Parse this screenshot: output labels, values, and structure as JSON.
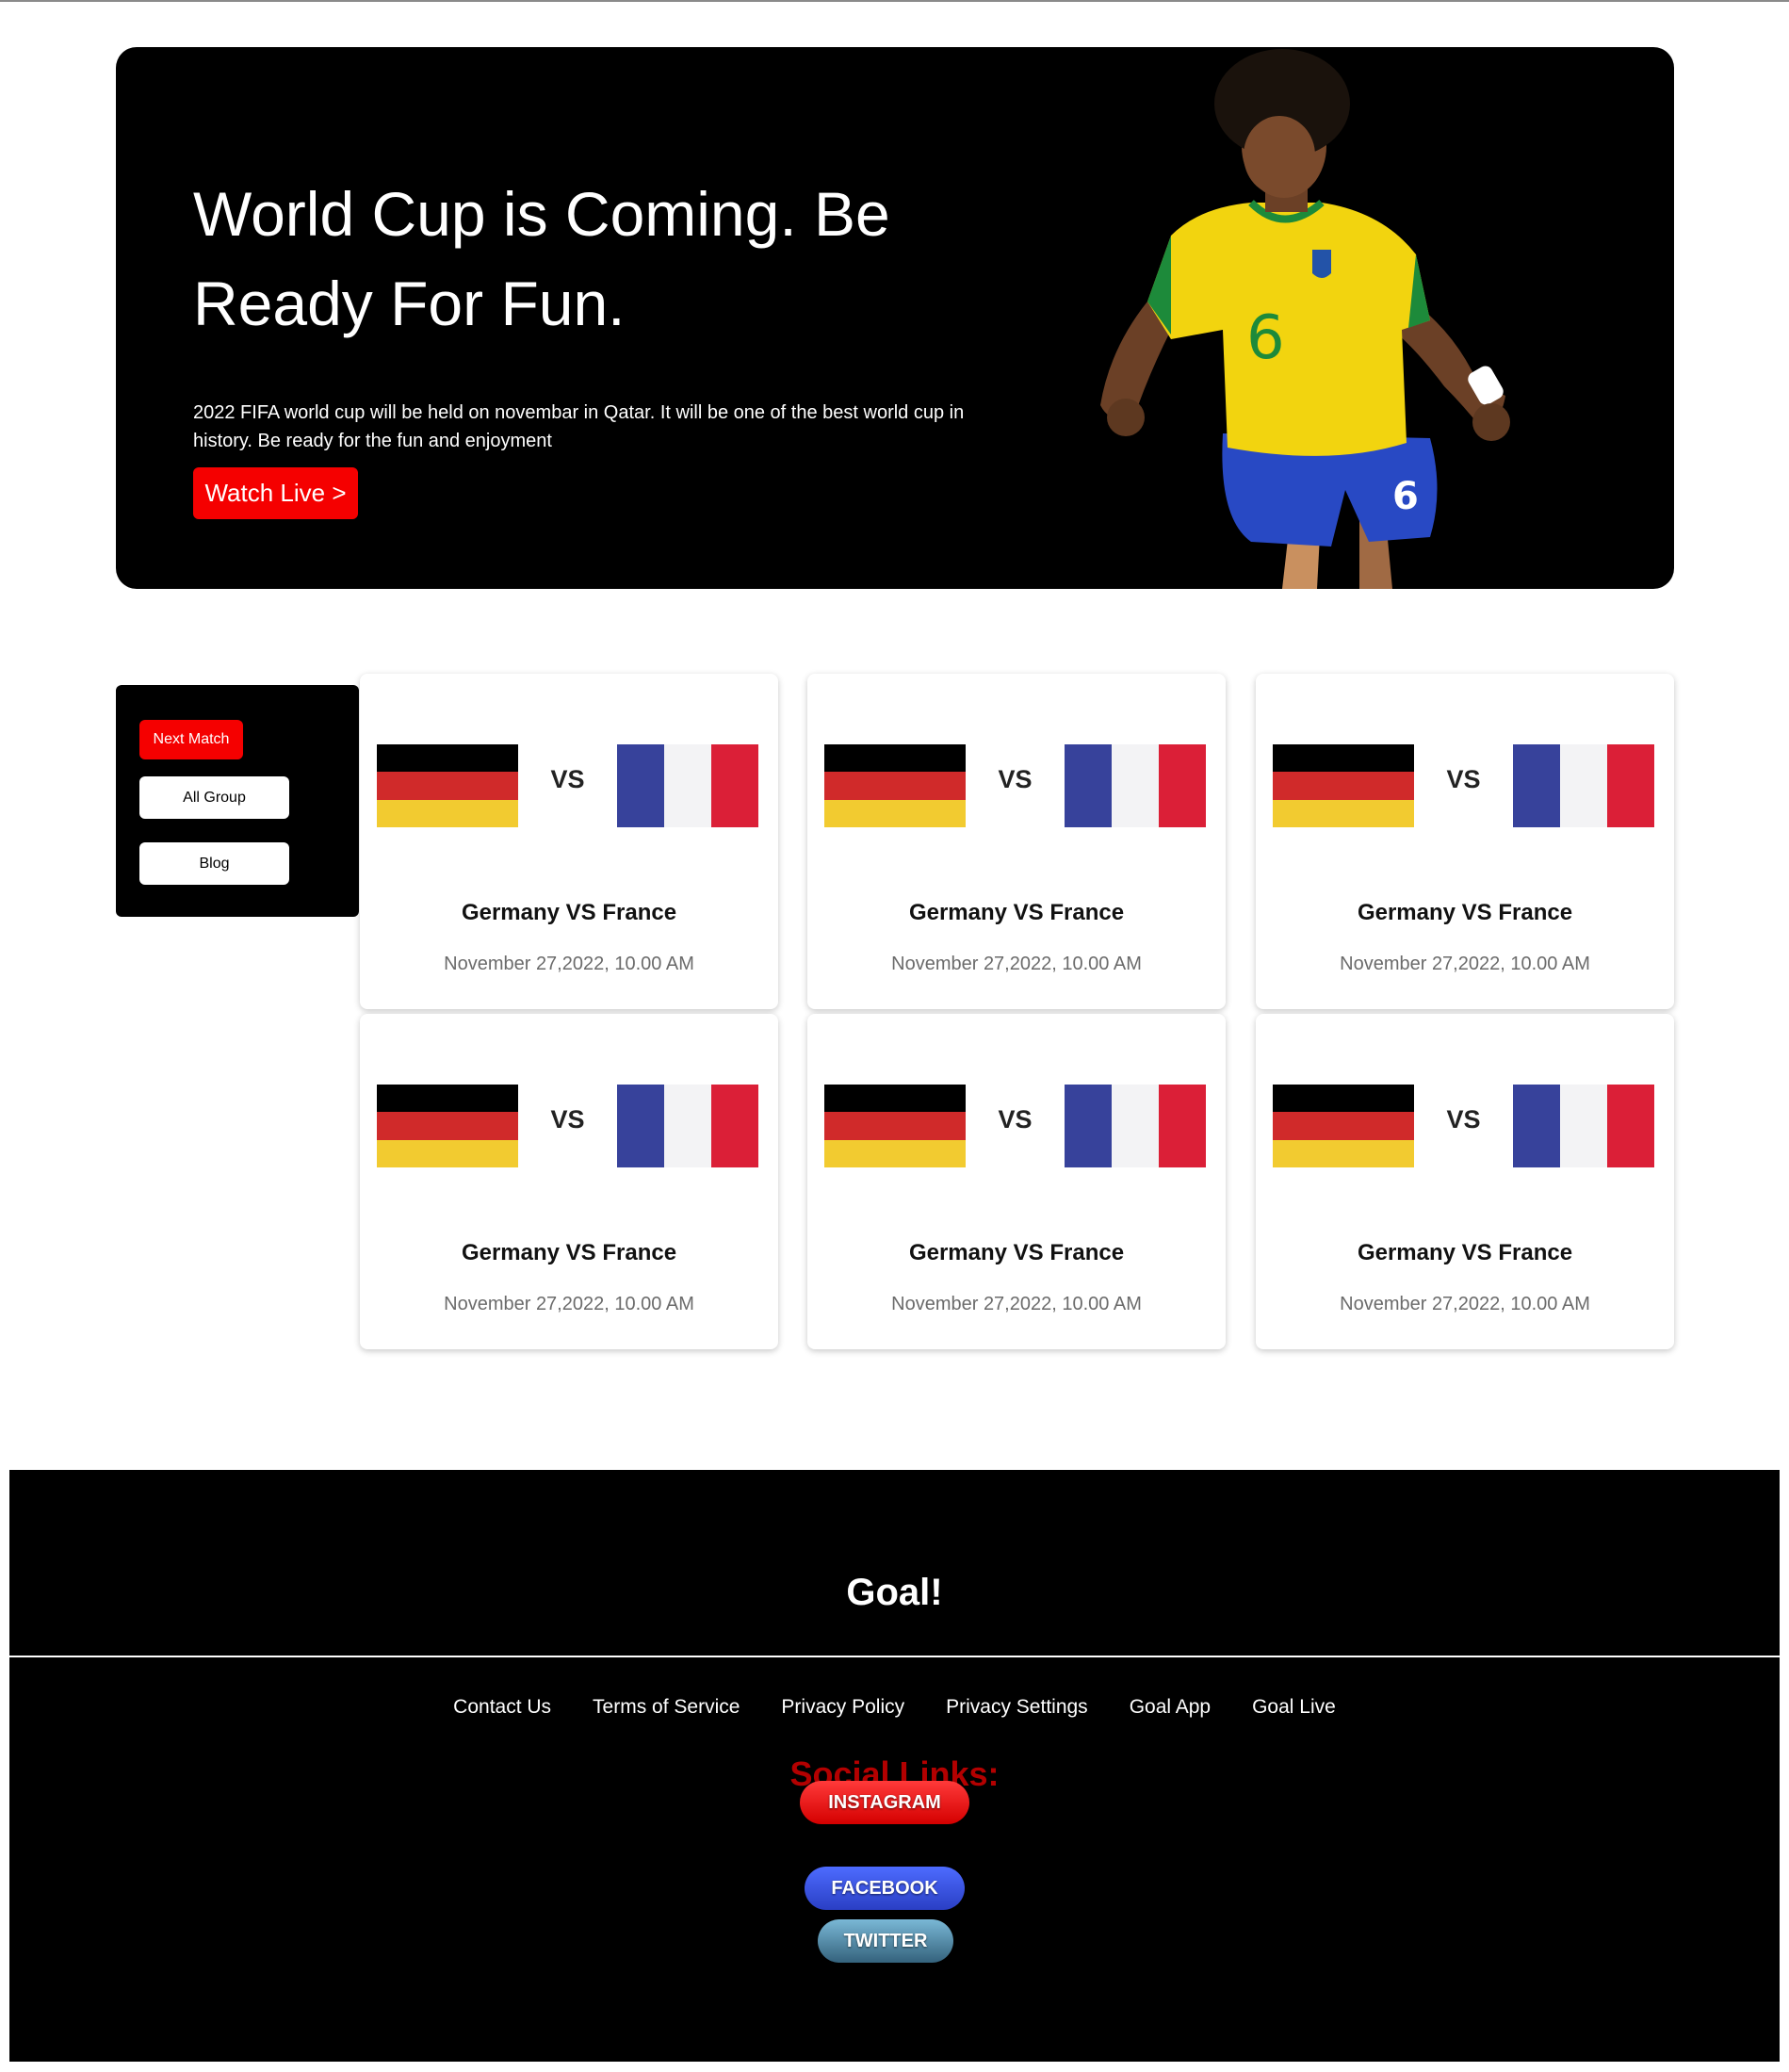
{
  "hero": {
    "title": "World Cup is Coming. Be Ready For Fun.",
    "description": "2022 FIFA world cup will be held on novembar in Qatar. It will be one of the best world cup in history. Be ready for the fun and enjoyment",
    "cta_label": "Watch Live >",
    "player_jersey_number": "6"
  },
  "sidebar": {
    "next_match_label": "Next Match",
    "all_group_label": "All Group",
    "blog_label": "Blog"
  },
  "matches": [
    {
      "vs": "VS",
      "title": "Germany VS France",
      "date": "November 27,2022, 10.00 AM"
    },
    {
      "vs": "VS",
      "title": "Germany VS France",
      "date": "November 27,2022, 10.00 AM"
    },
    {
      "vs": "VS",
      "title": "Germany VS France",
      "date": "November 27,2022, 10.00 AM"
    },
    {
      "vs": "VS",
      "title": "Germany VS France",
      "date": "November 27,2022, 10.00 AM"
    },
    {
      "vs": "VS",
      "title": "Germany VS France",
      "date": "November 27,2022, 10.00 AM"
    },
    {
      "vs": "VS",
      "title": "Germany VS France",
      "date": "November 27,2022, 10.00 AM"
    }
  ],
  "footer": {
    "brand": "Goal!",
    "links": [
      "Contact Us",
      "Terms of Service",
      "Privacy Policy",
      "Privacy Settings",
      "Goal App",
      "Goal Live"
    ],
    "social_title": "Social Links:",
    "social": {
      "instagram": "INSTAGRAM",
      "facebook": "FACEBOOK",
      "twitter": "TWITTER"
    }
  },
  "colors": {
    "accent_red": "#f50000",
    "germany": [
      "#000000",
      "#d02a2a",
      "#f2cb30"
    ],
    "france": [
      "#37429b",
      "#f3f3f5",
      "#db1f37"
    ]
  }
}
